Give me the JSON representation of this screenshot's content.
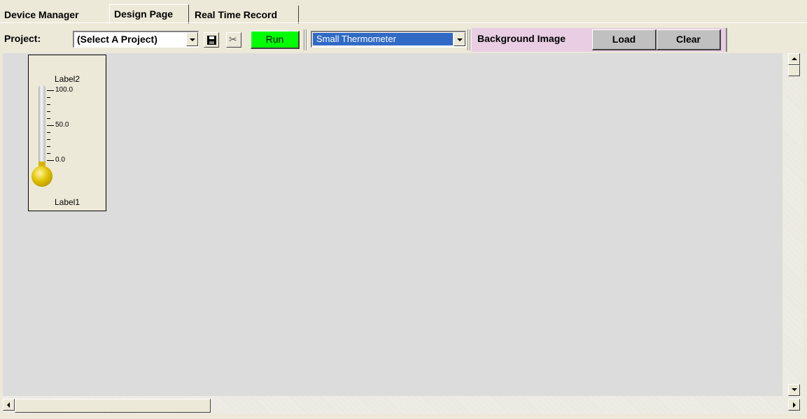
{
  "tabs": [
    {
      "label": "Device Manager"
    },
    {
      "label": "Design Page"
    },
    {
      "label": "Real Time Record"
    }
  ],
  "toolbar": {
    "project_label": "Project:",
    "project_select": "(Select A Project)",
    "save_icon": "floppy-disk-icon",
    "cut_icon": "scissors-icon",
    "run_label": "Run",
    "component_select": "Small Thermometer",
    "background_label": "Background Image",
    "load_label": "Load",
    "clear_label": "Clear"
  },
  "thermometer": {
    "top_label": "Label2",
    "bottom_label": "Label1",
    "scale": [
      "100.0",
      "50.0",
      "0.0"
    ]
  },
  "colors": {
    "run_button": "#00ff00",
    "background_panel": "#e8cde3",
    "selection": "#316ac5",
    "bulb": "#e0c000"
  }
}
